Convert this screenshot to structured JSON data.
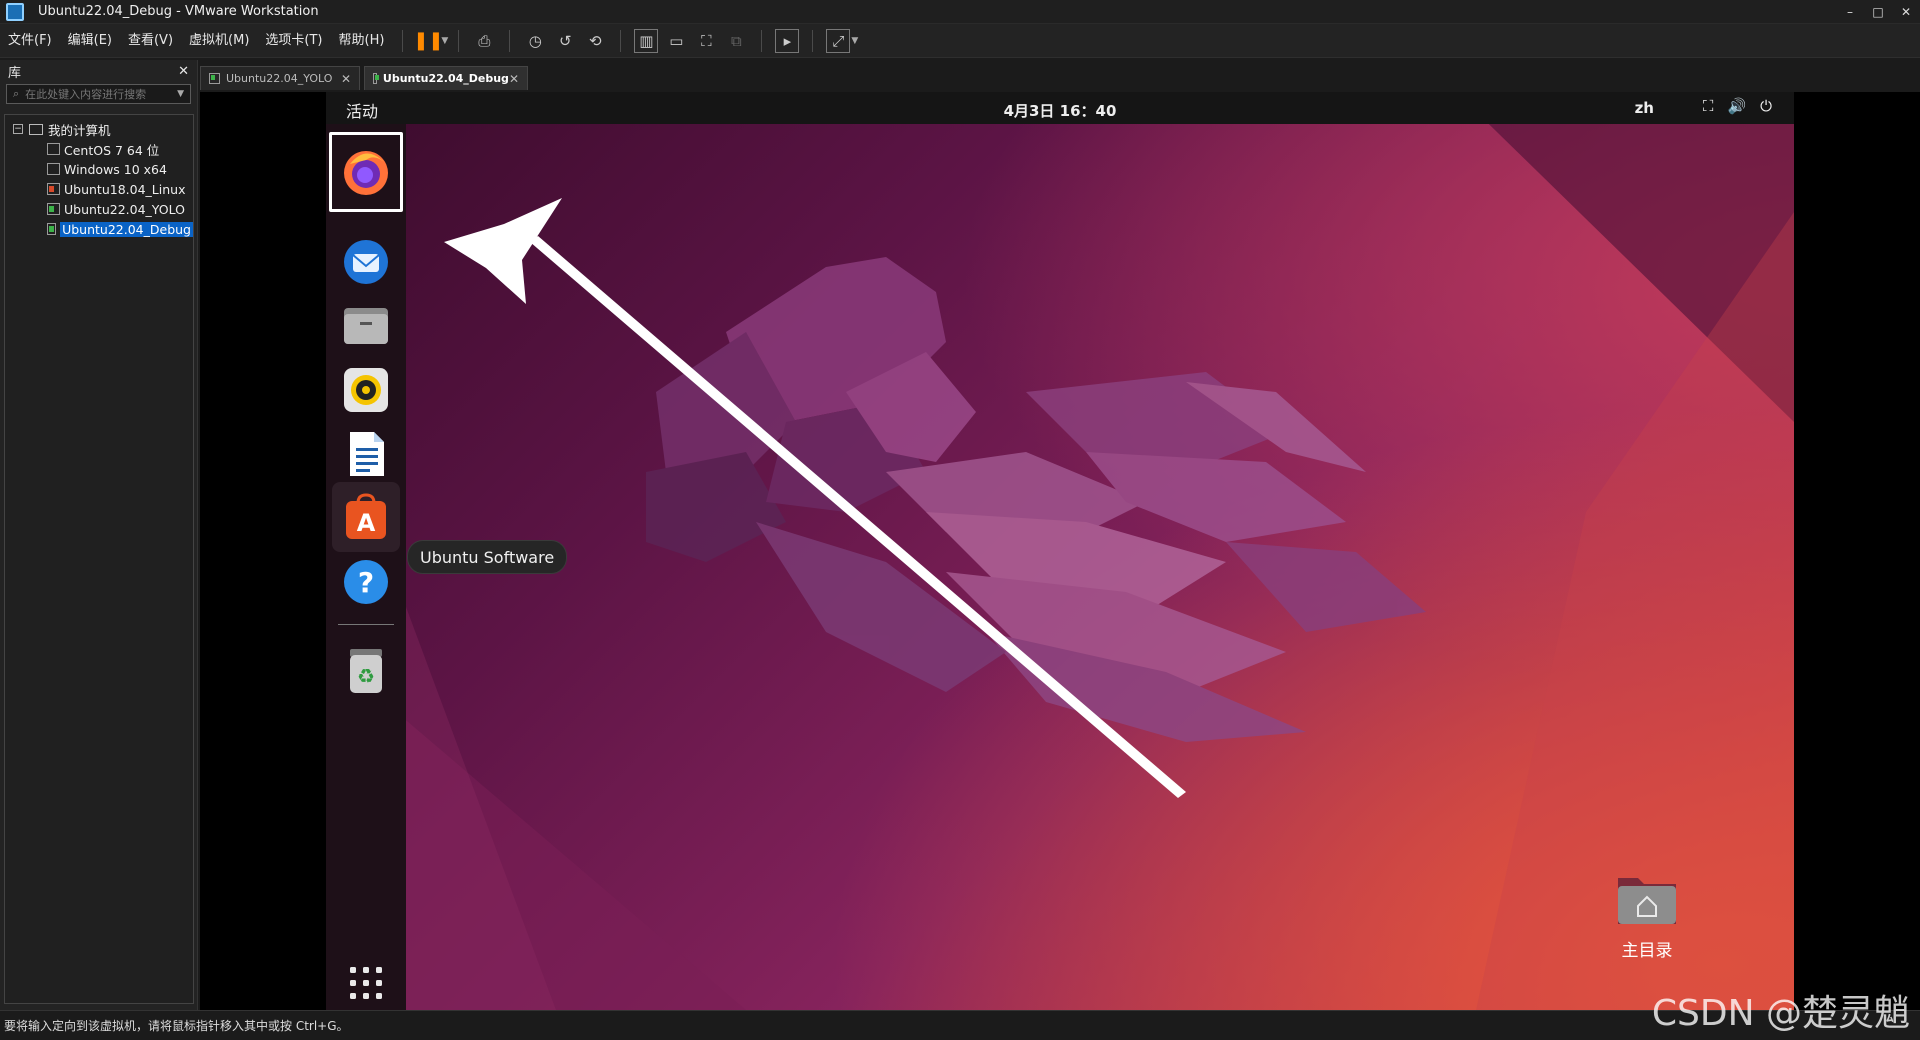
{
  "window": {
    "title": "Ubuntu22.04_Debug - VMware Workstation",
    "controls": [
      "–",
      "□",
      "✕"
    ]
  },
  "menu": [
    "文件(F)",
    "编辑(E)",
    "查看(V)",
    "虚拟机(M)",
    "选项卡(T)",
    "帮助(H)"
  ],
  "library": {
    "title": "库",
    "close": "✕",
    "search_placeholder": "在此处键入内容进行搜索",
    "root": "我的计算机",
    "items": [
      {
        "label": "CentOS 7 64 位",
        "state": "off"
      },
      {
        "label": "Windows 10 x64",
        "state": "off"
      },
      {
        "label": "Ubuntu18.04_Linux",
        "state": "legacy"
      },
      {
        "label": "Ubuntu22.04_YOLO",
        "state": "running"
      },
      {
        "label": "Ubuntu22.04_Debug",
        "state": "running",
        "selected": true
      }
    ]
  },
  "tabs": [
    {
      "label": "Ubuntu22.04_YOLO",
      "active": false
    },
    {
      "label": "Ubuntu22.04_Debug",
      "active": true
    }
  ],
  "ubuntu": {
    "activities": "活动",
    "clock": "4月3日  16：40",
    "lang": "zh",
    "sys_icons": [
      "network-icon",
      "volume-icon",
      "power-icon"
    ],
    "tooltip": "Ubuntu Software",
    "home_label": "主目录",
    "dock": [
      "firefox",
      "thunderbird",
      "files",
      "rhythmbox",
      "libreoffice-writer",
      "ubuntu-software",
      "help",
      "trash",
      "show-apps"
    ]
  },
  "statusbar": {
    "text": "要将输入定向到该虚拟机，请将鼠标指针移入其中或按 Ctrl+G。"
  },
  "watermark": "CSDN @楚灵魈"
}
